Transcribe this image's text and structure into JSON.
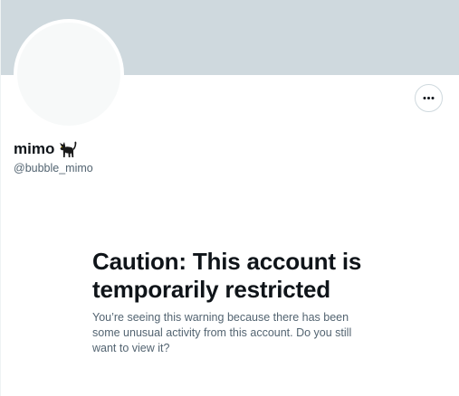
{
  "profile": {
    "display_name": "mimo",
    "name_emoji_icon": "black-cat-icon",
    "handle": "@bubble_mimo",
    "more_button_icon": "more-horizontal-icon"
  },
  "warning": {
    "title": "Caution: This account is temporarily restricted",
    "message": "You’re seeing this warning because there has been some unusual activity from this account. Do you still want to view it?"
  },
  "colors": {
    "banner": "#cfd9de",
    "avatar_placeholder": "#f7f9f9",
    "primary_text": "#0f1419",
    "secondary_text": "#536471",
    "border": "#cfd9de"
  }
}
